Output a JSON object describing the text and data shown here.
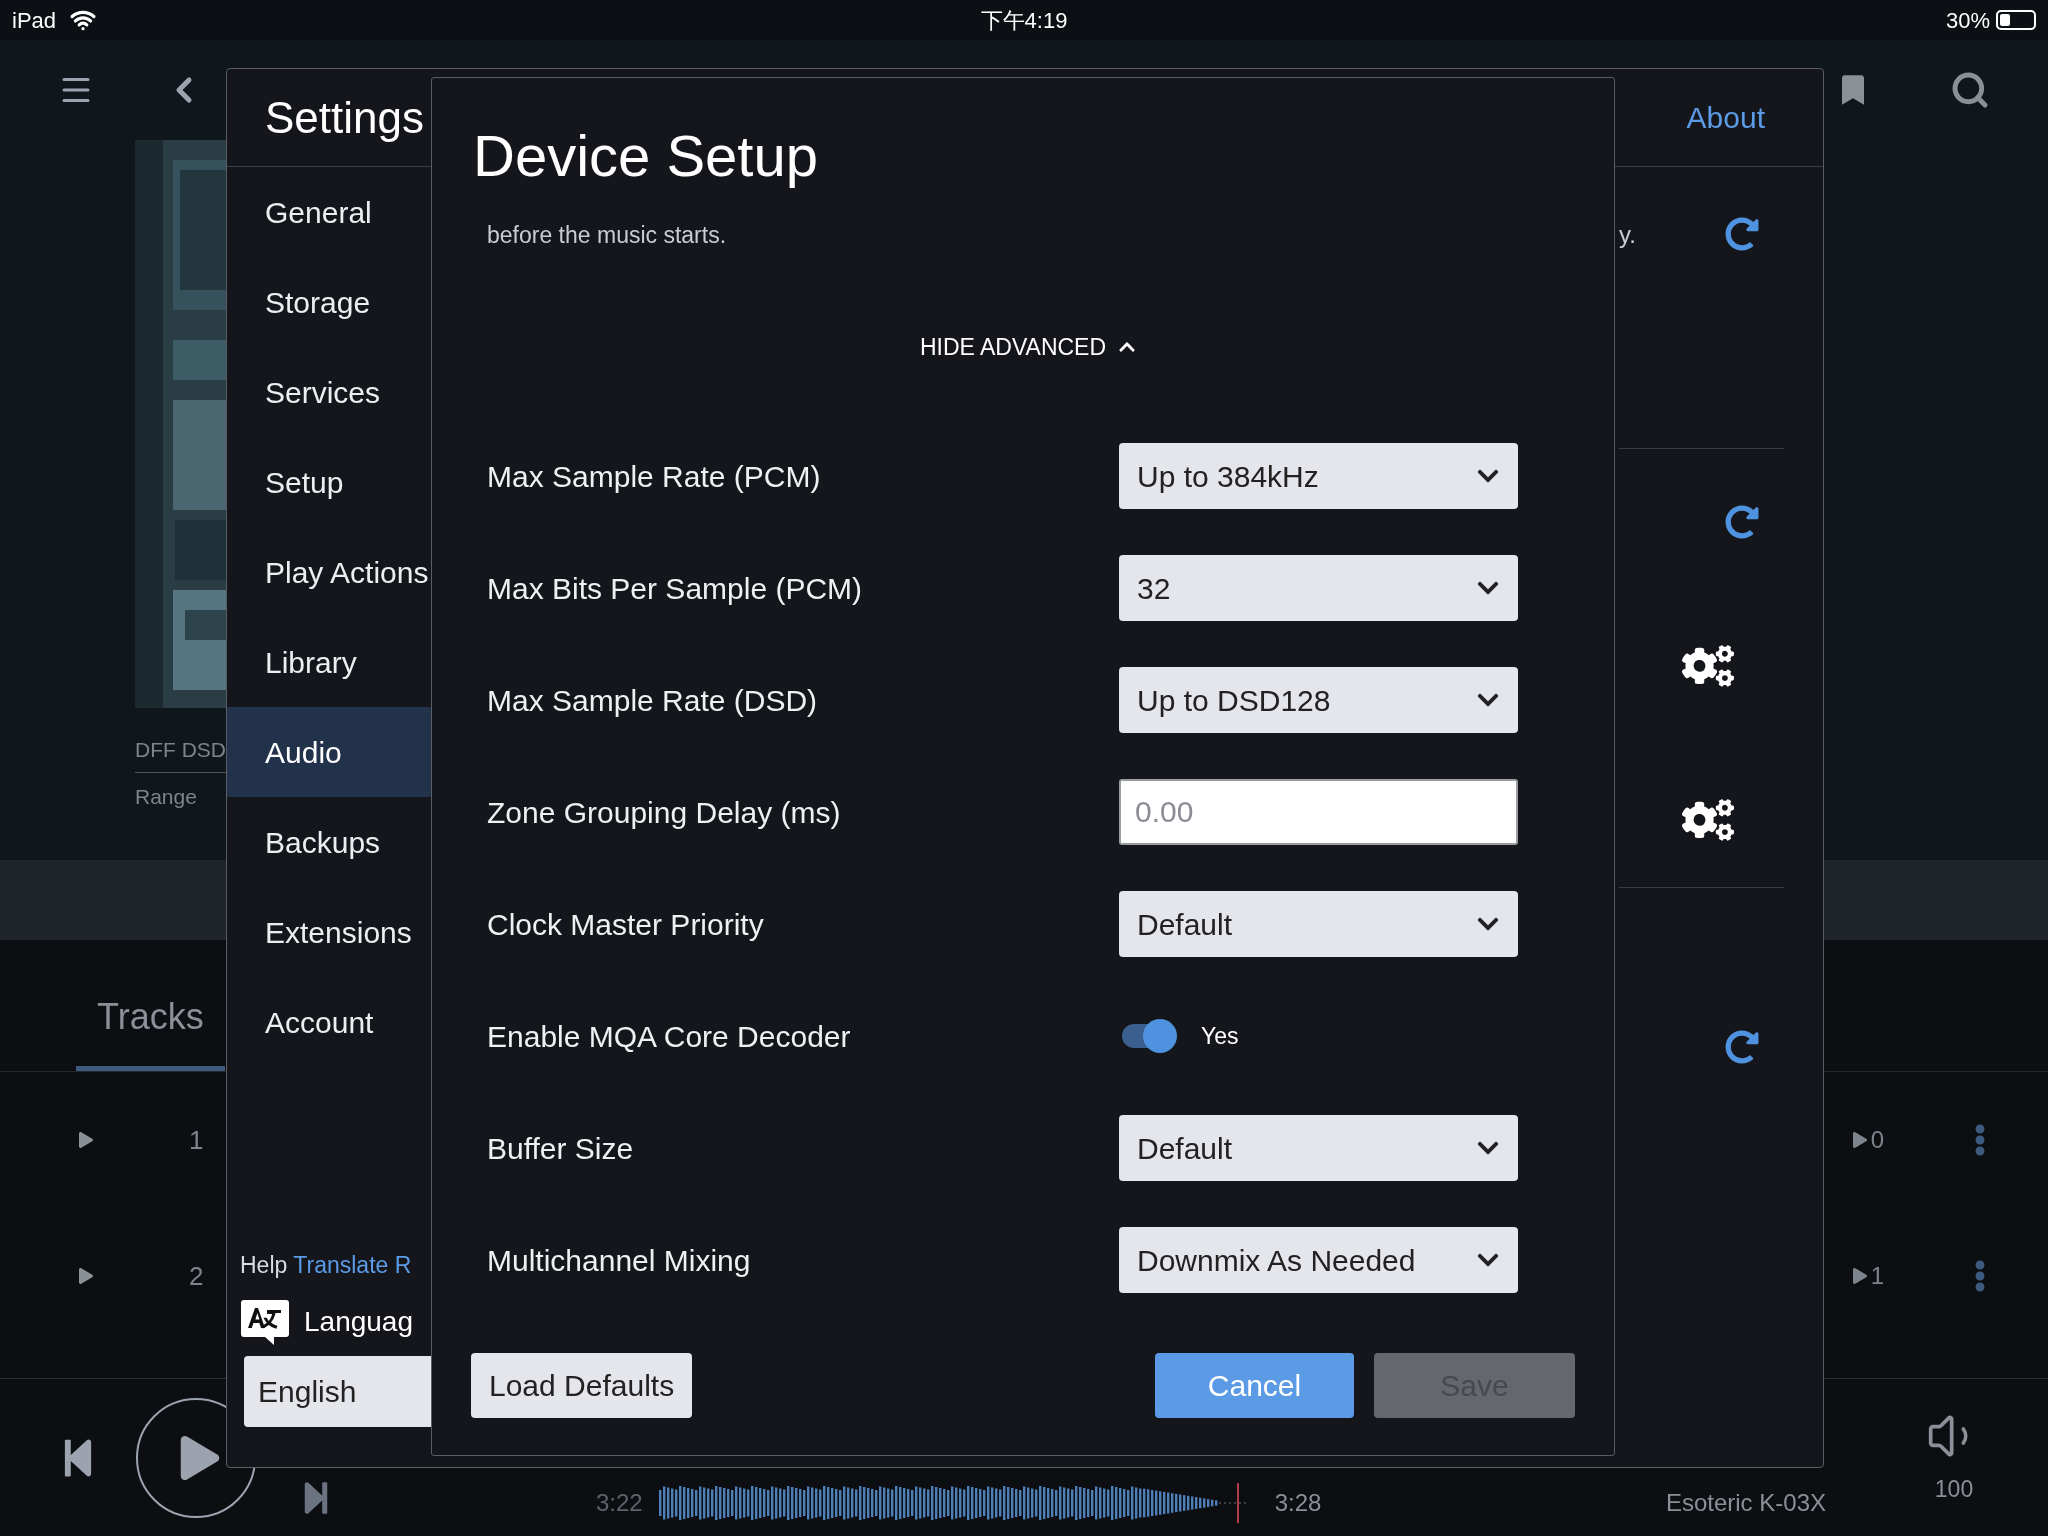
{
  "status_bar": {
    "device": "iPad",
    "time": "下午4:19",
    "battery": "30%"
  },
  "background": {
    "album_label": "DFF DSD",
    "album_sublabel": "Range",
    "tab": {
      "label": "Tracks",
      "selected": true
    },
    "tracks": [
      {
        "number": "1",
        "plays": "0"
      },
      {
        "number": "2",
        "plays": "1"
      }
    ],
    "player": {
      "elapsed": "3:22",
      "total": "3:28",
      "zone": "Esoteric K-03X",
      "volume": "100"
    }
  },
  "settings": {
    "title": "Settings",
    "about": "About",
    "fragment": "y.",
    "nav": [
      {
        "label": "General",
        "selected": false
      },
      {
        "label": "Storage",
        "selected": false
      },
      {
        "label": "Services",
        "selected": false
      },
      {
        "label": "Setup",
        "selected": false
      },
      {
        "label": "Play Actions",
        "selected": false
      },
      {
        "label": "Library",
        "selected": false
      },
      {
        "label": "Audio",
        "selected": true
      },
      {
        "label": "Backups",
        "selected": false
      },
      {
        "label": "Extensions",
        "selected": false
      },
      {
        "label": "Account",
        "selected": false
      }
    ],
    "help_text": "Help",
    "translate_link": "Translate R",
    "language_label": "Languag",
    "language_value": "English"
  },
  "dialog": {
    "title": "Device Setup",
    "description": "before the music starts.",
    "advanced_toggle": "HIDE ADVANCED",
    "expanded": true,
    "rows": [
      {
        "kind": "select",
        "label": "Max Sample Rate (PCM)",
        "value": "Up to 384kHz"
      },
      {
        "kind": "select",
        "label": "Max Bits Per Sample (PCM)",
        "value": "32"
      },
      {
        "kind": "select",
        "label": "Max Sample Rate (DSD)",
        "value": "Up to DSD128"
      },
      {
        "kind": "input",
        "label": "Zone Grouping Delay (ms)",
        "placeholder": "0.00"
      },
      {
        "kind": "select",
        "label": "Clock Master Priority",
        "value": "Default"
      },
      {
        "kind": "toggle",
        "label": "Enable MQA Core Decoder",
        "on": true,
        "value": "Yes"
      },
      {
        "kind": "select",
        "label": "Buffer Size",
        "value": "Default"
      },
      {
        "kind": "select",
        "label": "Multichannel Mixing",
        "value": "Downmix As Needed"
      }
    ],
    "load_defaults": "Load Defaults",
    "cancel": "Cancel",
    "save": {
      "label": "Save",
      "disabled": true
    }
  }
}
